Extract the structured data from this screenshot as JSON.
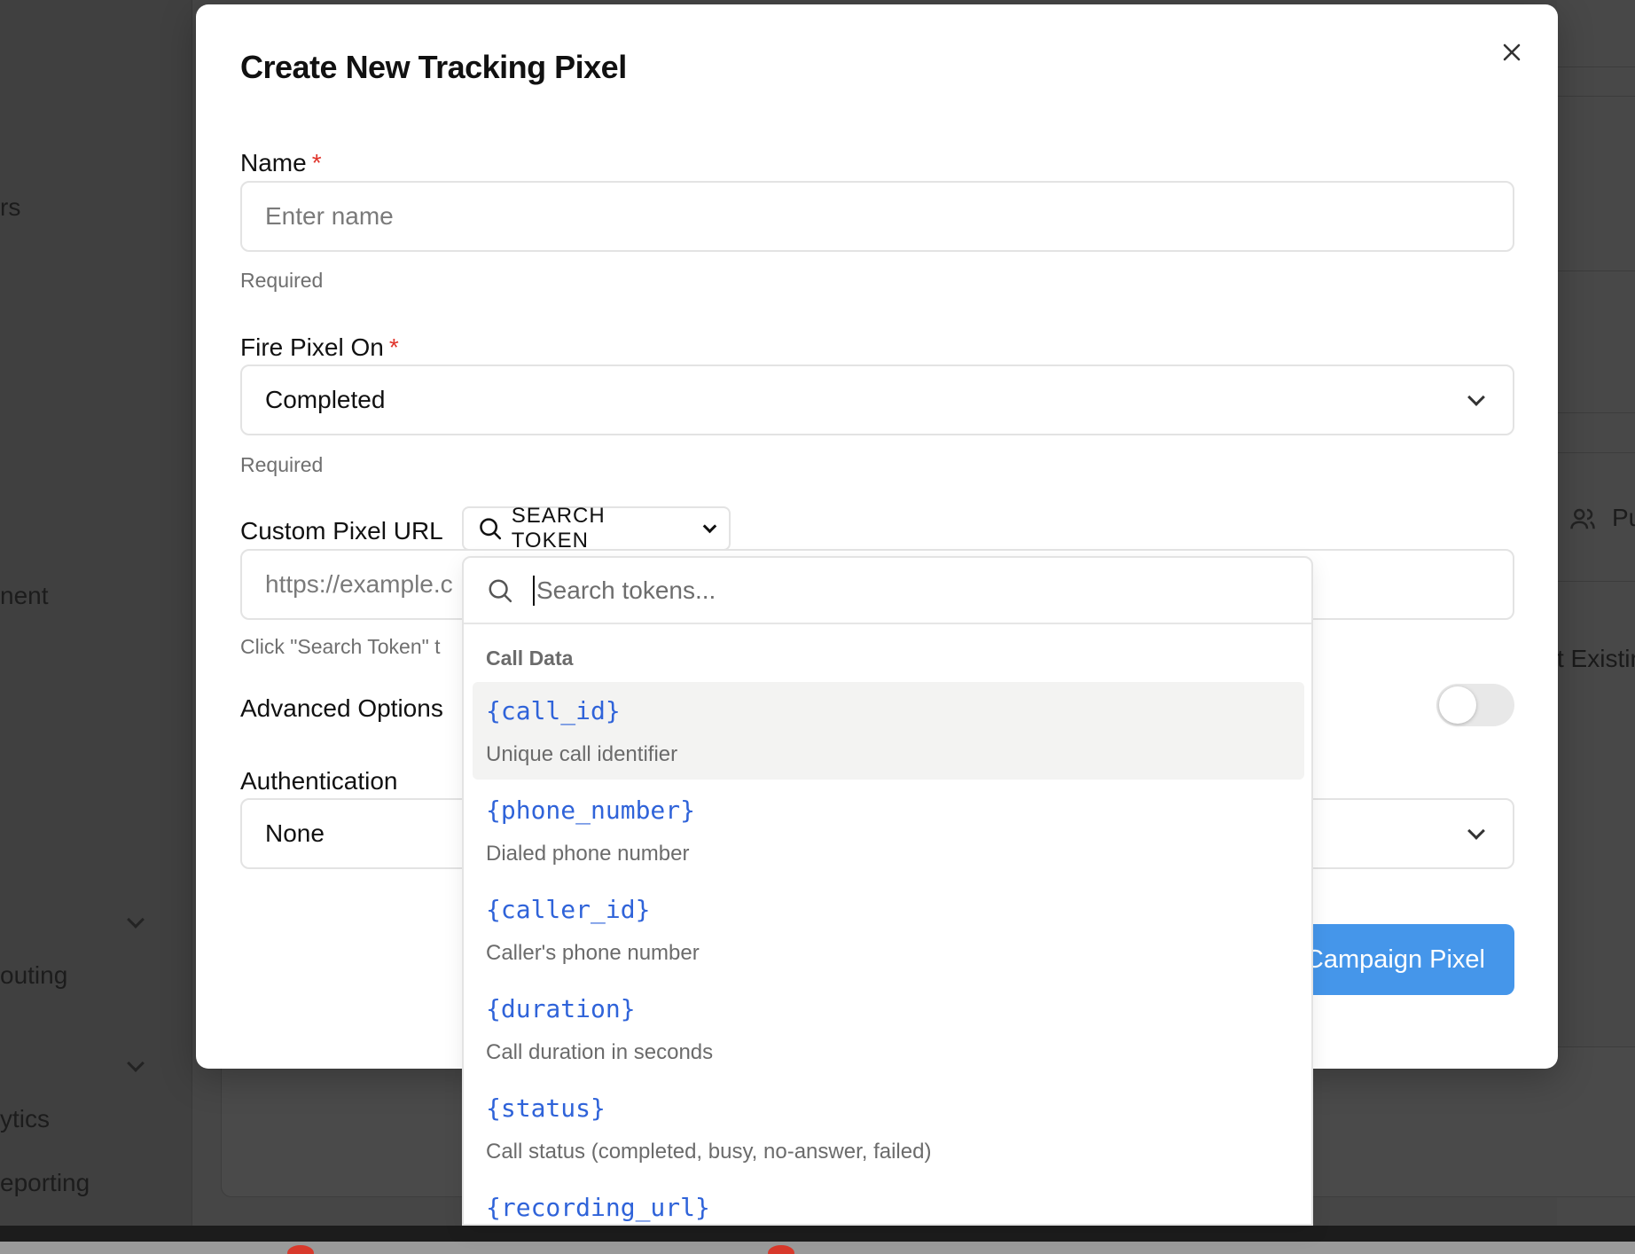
{
  "background": {
    "sidebar_fragments": [
      "rs",
      "nent",
      "outing",
      "ytics",
      "eporting"
    ],
    "right_fragments": [
      "Pu",
      "t Existir"
    ]
  },
  "modal": {
    "title": "Create New Tracking Pixel",
    "name_field": {
      "label": "Name",
      "required_mark": "*",
      "placeholder": "Enter name",
      "helper": "Required"
    },
    "fire_pixel_field": {
      "label": "Fire Pixel On",
      "required_mark": "*",
      "value": "Completed",
      "helper": "Required"
    },
    "custom_url_field": {
      "label": "Custom Pixel URL",
      "search_token_label": "SEARCH TOKEN",
      "placeholder": "https://example.c",
      "helper": "Click \"Search Token\" t"
    },
    "advanced_options": {
      "label": "Advanced Options",
      "enabled": false
    },
    "authentication": {
      "label": "Authentication",
      "value": "None"
    },
    "submit_label": "Campaign Pixel"
  },
  "token_dropdown": {
    "search_placeholder": "Search tokens...",
    "group_label": "Call Data",
    "items": [
      {
        "token": "{call_id}",
        "desc": "Unique call identifier"
      },
      {
        "token": "{phone_number}",
        "desc": "Dialed phone number"
      },
      {
        "token": "{caller_id}",
        "desc": "Caller's phone number"
      },
      {
        "token": "{duration}",
        "desc": "Call duration in seconds"
      },
      {
        "token": "{status}",
        "desc": "Call status (completed, busy, no-answer, failed)"
      },
      {
        "token": "{recording_url}",
        "desc": ""
      }
    ]
  },
  "colors": {
    "accent": "#4596ea",
    "token_blue": "#2f63d9",
    "required_red": "#e0342b",
    "overlay": "#464646"
  }
}
